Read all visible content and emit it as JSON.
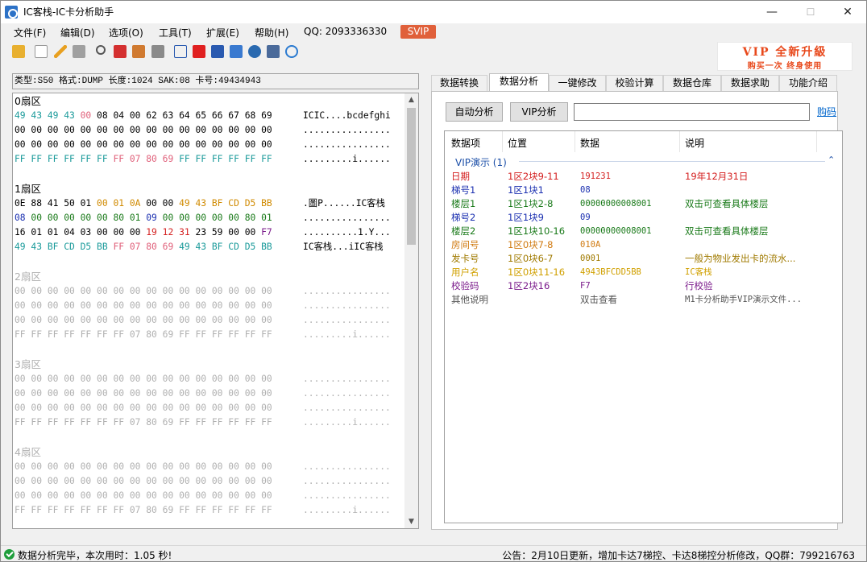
{
  "window": {
    "title": "IC客栈-IC卡分析助手",
    "minimize": "—",
    "maximize": "☐",
    "close": "✕"
  },
  "menu": [
    {
      "label": "文件(F)"
    },
    {
      "label": "编辑(D)"
    },
    {
      "label": "选项(O)"
    },
    {
      "label": "工具(T)"
    },
    {
      "label": "扩展(E)"
    },
    {
      "label": "帮助(H)"
    }
  ],
  "qq": "QQ:  2093336330",
  "svip": "SVIP",
  "vip_banner": {
    "line1": "VIP 全新升級",
    "line2": "购买一次     终身使用"
  },
  "toolbar_icons": [
    "folder-icon",
    "new-file-icon",
    "edit-icon",
    "save-icon",
    "search-icon",
    "calendar-icon",
    "chart-icon",
    "wand-icon",
    "report-icon",
    "nfc-icon",
    "device-icon",
    "read-card-icon",
    "find-icon",
    "copy-icon",
    "compare-icon",
    "settings-icon"
  ],
  "card_info": "类型:S50 格式:DUMP 长度:1024 SAK:08 卡号:49434943",
  "sectors": [
    {
      "title": "0扇区",
      "rows": [
        {
          "hex": "49 43 49 43 00 08 04 00 62 63 64 65 66 67 68 69",
          "ascii": "ICIC....bcdefghi"
        },
        {
          "hex": "00 00 00 00 00 00 00 00 00 00 00 00 00 00 00 00",
          "ascii": "................"
        },
        {
          "hex": "00 00 00 00 00 00 00 00 00 00 00 00 00 00 00 00",
          "ascii": "................"
        },
        {
          "hex": "FF FF FF FF FF FF FF 07 80 69 FF FF FF FF FF FF",
          "ascii": ".........i......"
        }
      ]
    },
    {
      "title": "1扇区",
      "rows": [
        {
          "hex": "0E 88 41 50 01 00 01 0A 00 00 49 43 BF CD D5 BB",
          "ascii": ".圖P......IC客栈"
        },
        {
          "hex": "08 00 00 00 00 00 80 01 09 00 00 00 00 00 80 01",
          "ascii": "................"
        },
        {
          "hex": "16 01 01 04 03 00 00 00 19 12 31 23 59 00 00 F7",
          "ascii": "..........1.Y..."
        },
        {
          "hex": "49 43 BF CD D5 BB FF 07 80 69 49 43 BF CD D5 BB",
          "ascii": "IC客栈...iIC客栈"
        }
      ]
    },
    {
      "title": "2扇区",
      "rows": [
        {
          "hex": "00 00 00 00 00 00 00 00 00 00 00 00 00 00 00 00",
          "ascii": "................"
        },
        {
          "hex": "00 00 00 00 00 00 00 00 00 00 00 00 00 00 00 00",
          "ascii": "................"
        },
        {
          "hex": "00 00 00 00 00 00 00 00 00 00 00 00 00 00 00 00",
          "ascii": "................"
        },
        {
          "hex": "FF FF FF FF FF FF FF 07 80 69 FF FF FF FF FF FF",
          "ascii": ".........i......"
        }
      ]
    },
    {
      "title": "3扇区",
      "rows": [
        {
          "hex": "00 00 00 00 00 00 00 00 00 00 00 00 00 00 00 00",
          "ascii": "................"
        },
        {
          "hex": "00 00 00 00 00 00 00 00 00 00 00 00 00 00 00 00",
          "ascii": "................"
        },
        {
          "hex": "00 00 00 00 00 00 00 00 00 00 00 00 00 00 00 00",
          "ascii": "................"
        },
        {
          "hex": "FF FF FF FF FF FF FF 07 80 69 FF FF FF FF FF FF",
          "ascii": ".........i......"
        }
      ]
    },
    {
      "title": "4扇区",
      "rows": [
        {
          "hex": "00 00 00 00 00 00 00 00 00 00 00 00 00 00 00 00",
          "ascii": "................"
        },
        {
          "hex": "00 00 00 00 00 00 00 00 00 00 00 00 00 00 00 00",
          "ascii": "................"
        },
        {
          "hex": "00 00 00 00 00 00 00 00 00 00 00 00 00 00 00 00",
          "ascii": "................"
        },
        {
          "hex": "FF FF FF FF FF FF FF 07 80 69 FF FF FF FF FF FF",
          "ascii": ".........i......"
        }
      ]
    }
  ],
  "tabs": [
    {
      "label": "数据转换"
    },
    {
      "label": "数据分析",
      "active": true
    },
    {
      "label": "一键修改"
    },
    {
      "label": "校验计算"
    },
    {
      "label": "数据仓库"
    },
    {
      "label": "数据求助"
    },
    {
      "label": "功能介绍"
    }
  ],
  "analysis": {
    "auto_button": "自动分析",
    "vip_button": "VIP分析",
    "input_value": "",
    "buy_link": "购码",
    "headers": [
      "数据项",
      "位置",
      "数据",
      "说明"
    ],
    "group_label": "VIP演示 (1)",
    "rows": [
      {
        "item": "日期",
        "pos": "1区2块9-11",
        "data": "191231",
        "desc": "19年12月31日",
        "color": "#d42020"
      },
      {
        "item": "梯号1",
        "pos": "1区1块1",
        "data": "08",
        "desc": "",
        "color": "#1a2fb0"
      },
      {
        "item": "楼层1",
        "pos": "1区1块2-8",
        "data": "00000000008001",
        "desc": "双击可查看具体楼层",
        "color": "#1a7a1a"
      },
      {
        "item": "梯号2",
        "pos": "1区1块9",
        "data": "09",
        "desc": "",
        "color": "#1a2fb0"
      },
      {
        "item": "楼层2",
        "pos": "1区1块10-16",
        "data": "00000000008001",
        "desc": "双击可查看具体楼层",
        "color": "#1a7a1a"
      },
      {
        "item": "房间号",
        "pos": "1区0块7-8",
        "data": "010A",
        "desc": "",
        "color": "#d07a10"
      },
      {
        "item": "发卡号",
        "pos": "1区0块6-7",
        "data": "0001",
        "desc": "一般为物业发出卡的流水...",
        "color": "#a07a00"
      },
      {
        "item": "用户名",
        "pos": "1区0块11-16",
        "data": "4943BFCDD5BB",
        "desc": "IC客栈",
        "color": "#d0a000"
      },
      {
        "item": "校验码",
        "pos": "1区2块16",
        "data": "F7",
        "desc": "行校验",
        "color": "#7a1a8a"
      },
      {
        "item": "其他说明",
        "pos": "",
        "data": "双击查看",
        "desc": "M1卡分析助手VIP演示文件...",
        "color": "#555555"
      }
    ]
  },
  "status": {
    "left": "数据分析完毕，本次用时：1.05 秒!",
    "right": "公告：2月10日更新，增加卡达7梯控、卡达8梯控分析修改，QQ群：799216763"
  },
  "colors": {
    "teal": "#1a9a9a",
    "red": "#d42020",
    "orange": "#d08a00",
    "pink": "#e0607a",
    "blue": "#1a2fb0",
    "green": "#1a7a1a",
    "purple": "#7a1a8a",
    "gray": "#b0b0b0"
  }
}
